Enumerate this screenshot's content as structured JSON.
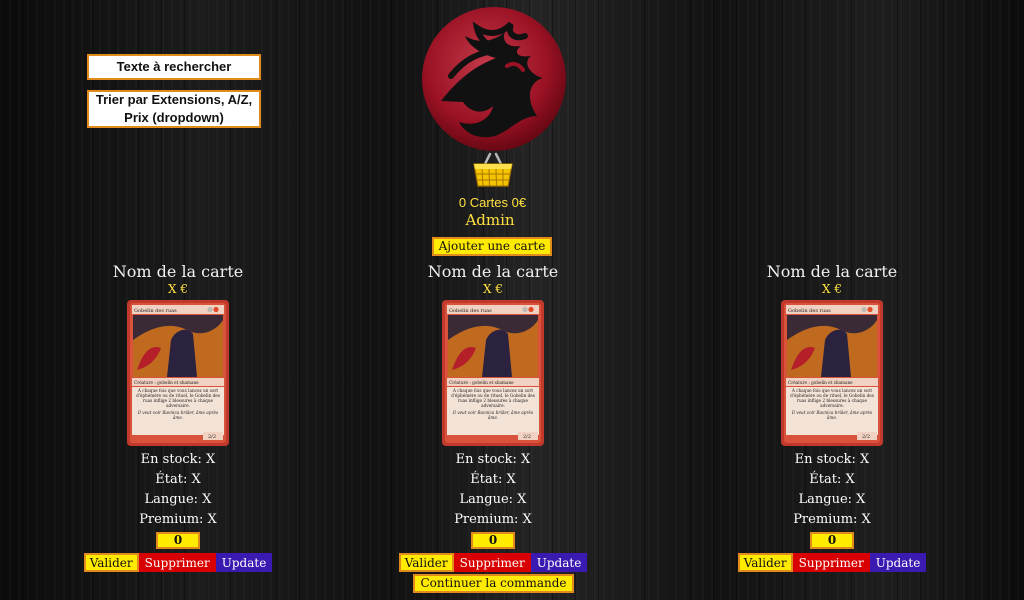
{
  "sidebar": {
    "search_label": "Texte à rechercher",
    "sort_label": "Trier par Extensions, A/Z, Prix (dropdown)"
  },
  "header": {
    "logo_icon": "red-mana-flame-logo",
    "basket_icon": "shopping-basket-icon",
    "cart_summary": "0 Cartes 0€",
    "user_role": "Admin",
    "add_card_label": "Ajouter une carte"
  },
  "cards": [
    {
      "name": "Nom de la carte",
      "price": "X €",
      "art_title": "Gobelin des ruas",
      "art_type": "Créature : gobelin et shamane",
      "art_text": "À chaque fois que vous lancez un sort d'éphémère ou de rituel, le Gobelin des ruas inflige 2 blessures à chaque adversaire.",
      "art_flavor": "Il veut voir Ravnica brûler, âme après âme.",
      "art_pt": "2/2",
      "stock": "En stock: X",
      "etat": "État: X",
      "langue": "Langue: X",
      "premium": "Premium: X",
      "qty": "0",
      "validate": "Valider",
      "delete": "Supprimer",
      "update": "Update"
    },
    {
      "name": "Nom de la carte",
      "price": "X €",
      "art_title": "Gobelin des ruas",
      "art_type": "Créature : gobelin et shamane",
      "art_text": "À chaque fois que vous lancez un sort d'éphémère ou de rituel, le Gobelin des ruas inflige 2 blessures à chaque adversaire.",
      "art_flavor": "Il veut voir Ravnica brûler, âme après âme.",
      "art_pt": "2/2",
      "stock": "En stock: X",
      "etat": "État: X",
      "langue": "Langue: X",
      "premium": "Premium: X",
      "qty": "0",
      "validate": "Valider",
      "delete": "Supprimer",
      "update": "Update"
    },
    {
      "name": "Nom de la carte",
      "price": "X €",
      "art_title": "Gobelin des ruas",
      "art_type": "Créature : gobelin et shamane",
      "art_text": "À chaque fois que vous lancez un sort d'éphémère ou de rituel, le Gobelin des ruas inflige 2 blessures à chaque adversaire.",
      "art_flavor": "Il veut voir Ravnica brûler, âme après âme.",
      "art_pt": "2/2",
      "stock": "En stock: X",
      "etat": "État: X",
      "langue": "Langue: X",
      "premium": "Premium: X",
      "qty": "0",
      "validate": "Valider",
      "delete": "Supprimer",
      "update": "Update"
    }
  ],
  "footer": {
    "continue_label": "Continuer la commande"
  },
  "colors": {
    "accent_yellow": "#ffeb00",
    "border_orange": "#e08b1c",
    "delete_red": "#d80000",
    "update_purple": "#3a1ab0"
  }
}
